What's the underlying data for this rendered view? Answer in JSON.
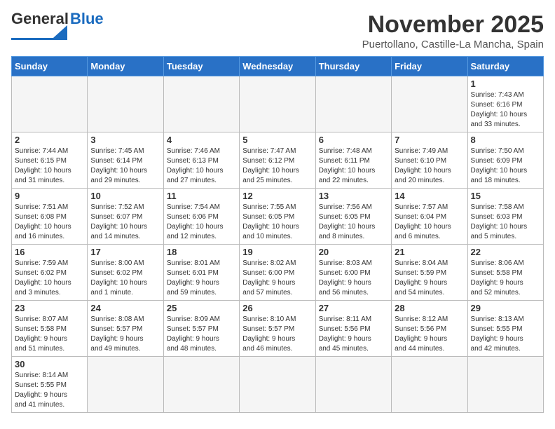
{
  "header": {
    "logo_text1": "General",
    "logo_text2": "Blue",
    "month_title": "November 2025",
    "location": "Puertollano, Castille-La Mancha, Spain"
  },
  "weekdays": [
    "Sunday",
    "Monday",
    "Tuesday",
    "Wednesday",
    "Thursday",
    "Friday",
    "Saturday"
  ],
  "days": [
    {
      "date": "",
      "info": ""
    },
    {
      "date": "",
      "info": ""
    },
    {
      "date": "",
      "info": ""
    },
    {
      "date": "",
      "info": ""
    },
    {
      "date": "",
      "info": ""
    },
    {
      "date": "",
      "info": ""
    },
    {
      "date": "1",
      "info": "Sunrise: 7:43 AM\nSunset: 6:16 PM\nDaylight: 10 hours\nand 33 minutes."
    },
    {
      "date": "2",
      "info": "Sunrise: 7:44 AM\nSunset: 6:15 PM\nDaylight: 10 hours\nand 31 minutes."
    },
    {
      "date": "3",
      "info": "Sunrise: 7:45 AM\nSunset: 6:14 PM\nDaylight: 10 hours\nand 29 minutes."
    },
    {
      "date": "4",
      "info": "Sunrise: 7:46 AM\nSunset: 6:13 PM\nDaylight: 10 hours\nand 27 minutes."
    },
    {
      "date": "5",
      "info": "Sunrise: 7:47 AM\nSunset: 6:12 PM\nDaylight: 10 hours\nand 25 minutes."
    },
    {
      "date": "6",
      "info": "Sunrise: 7:48 AM\nSunset: 6:11 PM\nDaylight: 10 hours\nand 22 minutes."
    },
    {
      "date": "7",
      "info": "Sunrise: 7:49 AM\nSunset: 6:10 PM\nDaylight: 10 hours\nand 20 minutes."
    },
    {
      "date": "8",
      "info": "Sunrise: 7:50 AM\nSunset: 6:09 PM\nDaylight: 10 hours\nand 18 minutes."
    },
    {
      "date": "9",
      "info": "Sunrise: 7:51 AM\nSunset: 6:08 PM\nDaylight: 10 hours\nand 16 minutes."
    },
    {
      "date": "10",
      "info": "Sunrise: 7:52 AM\nSunset: 6:07 PM\nDaylight: 10 hours\nand 14 minutes."
    },
    {
      "date": "11",
      "info": "Sunrise: 7:54 AM\nSunset: 6:06 PM\nDaylight: 10 hours\nand 12 minutes."
    },
    {
      "date": "12",
      "info": "Sunrise: 7:55 AM\nSunset: 6:05 PM\nDaylight: 10 hours\nand 10 minutes."
    },
    {
      "date": "13",
      "info": "Sunrise: 7:56 AM\nSunset: 6:05 PM\nDaylight: 10 hours\nand 8 minutes."
    },
    {
      "date": "14",
      "info": "Sunrise: 7:57 AM\nSunset: 6:04 PM\nDaylight: 10 hours\nand 6 minutes."
    },
    {
      "date": "15",
      "info": "Sunrise: 7:58 AM\nSunset: 6:03 PM\nDaylight: 10 hours\nand 5 minutes."
    },
    {
      "date": "16",
      "info": "Sunrise: 7:59 AM\nSunset: 6:02 PM\nDaylight: 10 hours\nand 3 minutes."
    },
    {
      "date": "17",
      "info": "Sunrise: 8:00 AM\nSunset: 6:02 PM\nDaylight: 10 hours\nand 1 minute."
    },
    {
      "date": "18",
      "info": "Sunrise: 8:01 AM\nSunset: 6:01 PM\nDaylight: 9 hours\nand 59 minutes."
    },
    {
      "date": "19",
      "info": "Sunrise: 8:02 AM\nSunset: 6:00 PM\nDaylight: 9 hours\nand 57 minutes."
    },
    {
      "date": "20",
      "info": "Sunrise: 8:03 AM\nSunset: 6:00 PM\nDaylight: 9 hours\nand 56 minutes."
    },
    {
      "date": "21",
      "info": "Sunrise: 8:04 AM\nSunset: 5:59 PM\nDaylight: 9 hours\nand 54 minutes."
    },
    {
      "date": "22",
      "info": "Sunrise: 8:06 AM\nSunset: 5:58 PM\nDaylight: 9 hours\nand 52 minutes."
    },
    {
      "date": "23",
      "info": "Sunrise: 8:07 AM\nSunset: 5:58 PM\nDaylight: 9 hours\nand 51 minutes."
    },
    {
      "date": "24",
      "info": "Sunrise: 8:08 AM\nSunset: 5:57 PM\nDaylight: 9 hours\nand 49 minutes."
    },
    {
      "date": "25",
      "info": "Sunrise: 8:09 AM\nSunset: 5:57 PM\nDaylight: 9 hours\nand 48 minutes."
    },
    {
      "date": "26",
      "info": "Sunrise: 8:10 AM\nSunset: 5:57 PM\nDaylight: 9 hours\nand 46 minutes."
    },
    {
      "date": "27",
      "info": "Sunrise: 8:11 AM\nSunset: 5:56 PM\nDaylight: 9 hours\nand 45 minutes."
    },
    {
      "date": "28",
      "info": "Sunrise: 8:12 AM\nSunset: 5:56 PM\nDaylight: 9 hours\nand 44 minutes."
    },
    {
      "date": "29",
      "info": "Sunrise: 8:13 AM\nSunset: 5:55 PM\nDaylight: 9 hours\nand 42 minutes."
    },
    {
      "date": "30",
      "info": "Sunrise: 8:14 AM\nSunset: 5:55 PM\nDaylight: 9 hours\nand 41 minutes."
    },
    {
      "date": "",
      "info": ""
    },
    {
      "date": "",
      "info": ""
    },
    {
      "date": "",
      "info": ""
    },
    {
      "date": "",
      "info": ""
    },
    {
      "date": "",
      "info": ""
    },
    {
      "date": "",
      "info": ""
    }
  ]
}
